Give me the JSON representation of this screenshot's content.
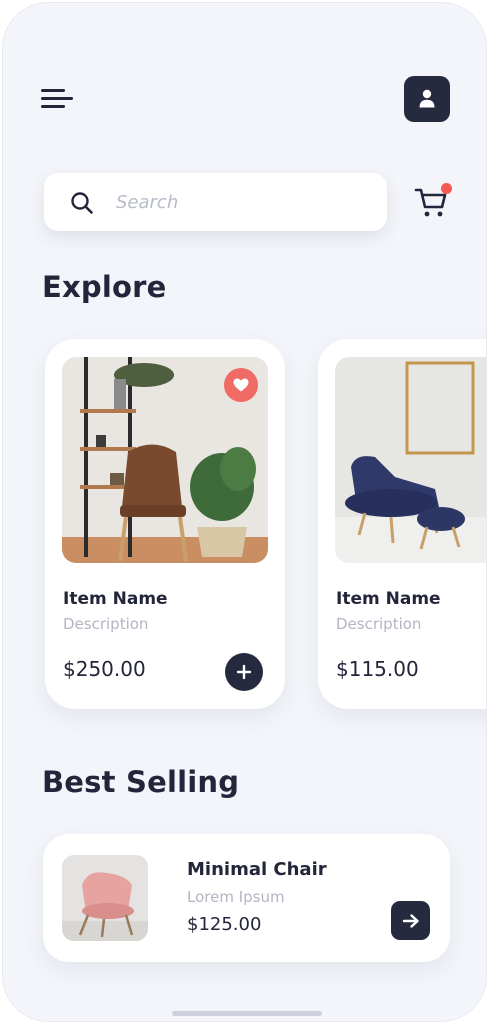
{
  "header": {
    "menu_icon": "hamburger-menu-icon",
    "profile_icon": "user-icon",
    "cart_icon": "shopping-cart-icon"
  },
  "search": {
    "placeholder": "Search",
    "value": ""
  },
  "explore": {
    "title": "Explore",
    "cards": [
      {
        "name": "Item Name",
        "description": "Description",
        "price": "$250.00",
        "image": "brown leather chair with plant and shelf",
        "favorited": true
      },
      {
        "name": "Item Name",
        "description": "Description",
        "price": "$115.00",
        "image": "navy blue armchair with ottoman"
      }
    ]
  },
  "best_selling": {
    "title": "Best Selling",
    "items": [
      {
        "name": "Minimal Chair",
        "description": "Lorem Ipsum",
        "price": "$125.00",
        "image": "pink armchair"
      }
    ]
  },
  "colors": {
    "background": "#f3f5fa",
    "primary_dark": "#262a3f",
    "accent_red": "#f25a52",
    "muted_text": "#b2b6c2"
  }
}
